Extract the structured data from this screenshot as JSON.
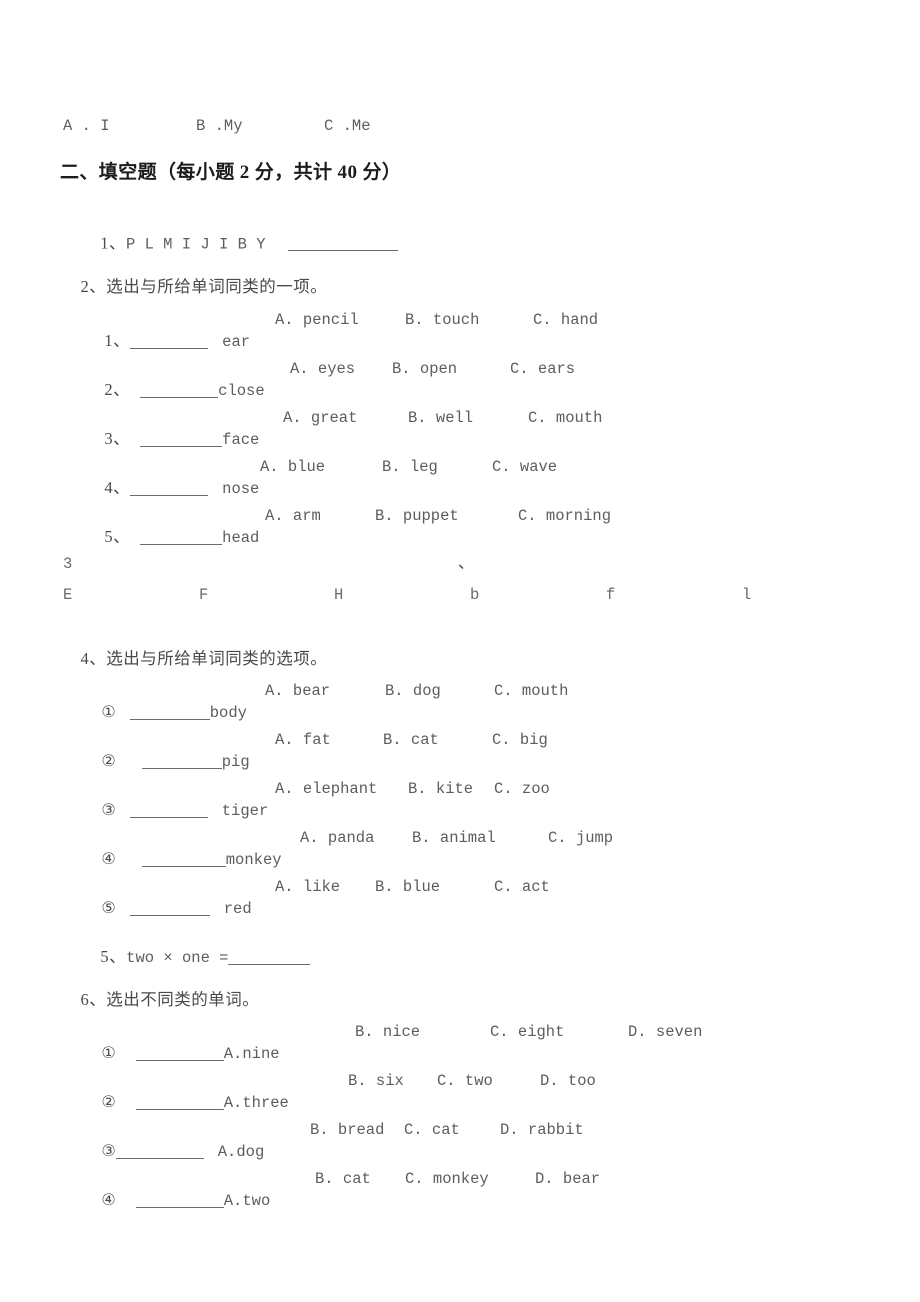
{
  "document": {
    "kind": "exam-paper",
    "language": "zh-CN + en"
  },
  "carryover_options": {
    "a": "A . I",
    "b": "B .My",
    "c": "C .Me"
  },
  "section_heading": "二、填空题（每小题 2 分，共计 40 分）",
  "q1": {
    "number": "1、",
    "letters": "P L M I J I B Y",
    "blank": ""
  },
  "q2": {
    "number": "2、",
    "prompt": "选出与所给单词同类的一项。",
    "items": [
      {
        "num": "1、",
        "word": "ear",
        "a": "A. pencil",
        "b": "B. touch",
        "c": "C. hand"
      },
      {
        "num": "2、",
        "word": "close",
        "a": "A. eyes",
        "b": "B. open",
        "c": "C. ears"
      },
      {
        "num": "3、",
        "word": "face",
        "a": "A. great",
        "b": "B. well",
        "c": "C. mouth"
      },
      {
        "num": "4、",
        "word": "nose",
        "a": "A. blue",
        "b": "B. leg",
        "c": "C. wave"
      },
      {
        "num": "5、",
        "word": "head",
        "a": "A. arm",
        "b": "B. puppet",
        "c": "C. morning"
      }
    ]
  },
  "q3": {
    "number": "3",
    "tick": "、",
    "letters": [
      "E",
      "F",
      "H",
      "b",
      "f",
      "l"
    ]
  },
  "q4": {
    "number": "4、",
    "prompt": "选出与所给单词同类的选项。",
    "items": [
      {
        "num": "①",
        "word": "body",
        "a": "A. bear",
        "b": "B. dog",
        "c": "C. mouth"
      },
      {
        "num": "②",
        "word": "pig",
        "a": "A. fat",
        "b": "B. cat",
        "c": "C. big"
      },
      {
        "num": "③",
        "word": "tiger",
        "a": "A. elephant",
        "b": "B. kite",
        "c": "C. zoo"
      },
      {
        "num": "④",
        "word": "monkey",
        "a": "A. panda",
        "b": "B. animal",
        "c": "C. jump"
      },
      {
        "num": "⑤",
        "word": "red",
        "a": "A. like",
        "b": "B. blue",
        "c": "C. act"
      }
    ]
  },
  "q5": {
    "number": "5、",
    "expression": "two × one ="
  },
  "q6": {
    "number": "6、",
    "prompt": "选出不同类的单词。",
    "items": [
      {
        "num": "①",
        "a": "A.nine",
        "b": "B. nice",
        "c": "C. eight",
        "d": "D. seven"
      },
      {
        "num": "②",
        "a": "A.three",
        "b": "B. six",
        "c": "C. two",
        "d": "D. too"
      },
      {
        "num": "③",
        "a": "A.dog",
        "b": "B. bread",
        "c": "C. cat",
        "d": "D. rabbit"
      },
      {
        "num": "④",
        "a": "A.two",
        "b": "B. cat",
        "c": "C. monkey",
        "d": "D. bear"
      }
    ]
  }
}
